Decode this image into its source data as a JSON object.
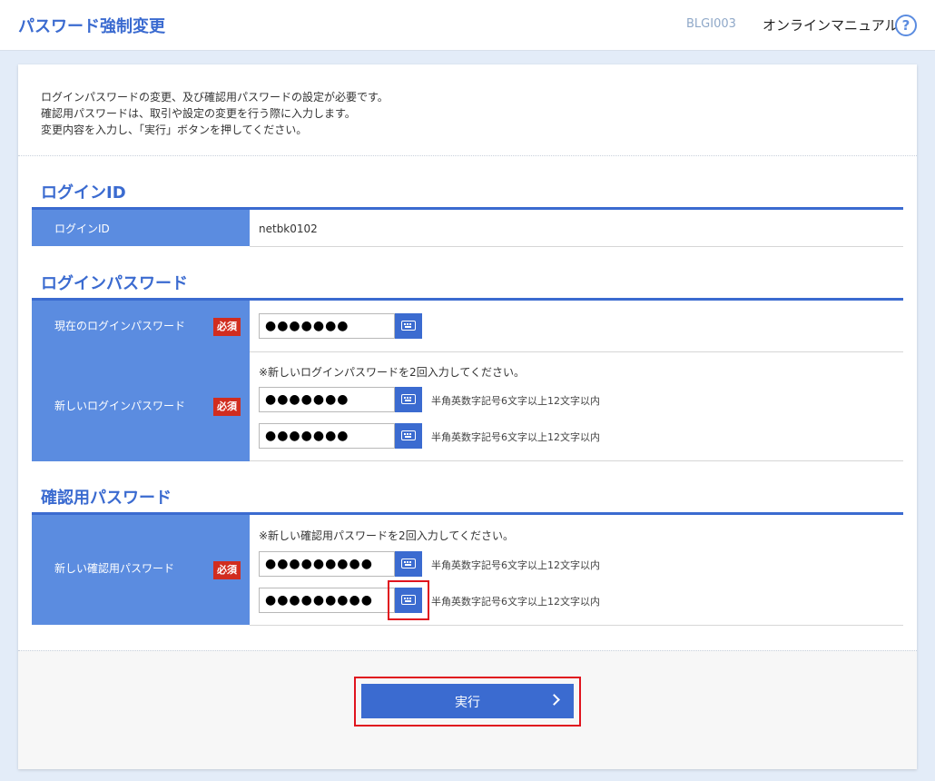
{
  "header": {
    "title": "パスワード強制変更",
    "screen_id": "BLGI003",
    "manual_label": "オンラインマニュアル",
    "help_glyph": "?"
  },
  "intro": {
    "lines": [
      "ログインパスワードの変更、及び確認用パスワードの設定が必要です。",
      "確認用パスワードは、取引や設定の変更を行う際に入力します。",
      "変更内容を入力し、「実行」ボタンを押してください。"
    ]
  },
  "login_id": {
    "section_title": "ログインID",
    "label": "ログインID",
    "value": "netbk0102"
  },
  "login_password": {
    "section_title": "ログインパスワード",
    "current_label": "現在のログインパスワード",
    "current_value": "●●●●●●●",
    "new_label": "新しいログインパスワード",
    "new_note": "※新しいログインパスワードを2回入力してください。",
    "new_value_1": "●●●●●●●",
    "new_value_2": "●●●●●●●",
    "hint": "半角英数字記号6文字以上12文字以内"
  },
  "confirm_password": {
    "section_title": "確認用パスワード",
    "new_label": "新しい確認用パスワード",
    "new_note": "※新しい確認用パスワードを2回入力してください。",
    "new_value_1": "●●●●●●●●●",
    "new_value_2": "●●●●●●●●●",
    "hint": "半角英数字記号6文字以上12文字以内"
  },
  "required_badge": "必須",
  "execute_label": "実行",
  "colors": {
    "accent": "#3b6bd0",
    "header_cell": "#5b8ce0",
    "required": "#d12d1f",
    "highlight": "#e0141e"
  },
  "icons": {
    "keyboard": "keyboard-icon",
    "help": "help-icon",
    "chevron": "chevron-right-icon"
  }
}
